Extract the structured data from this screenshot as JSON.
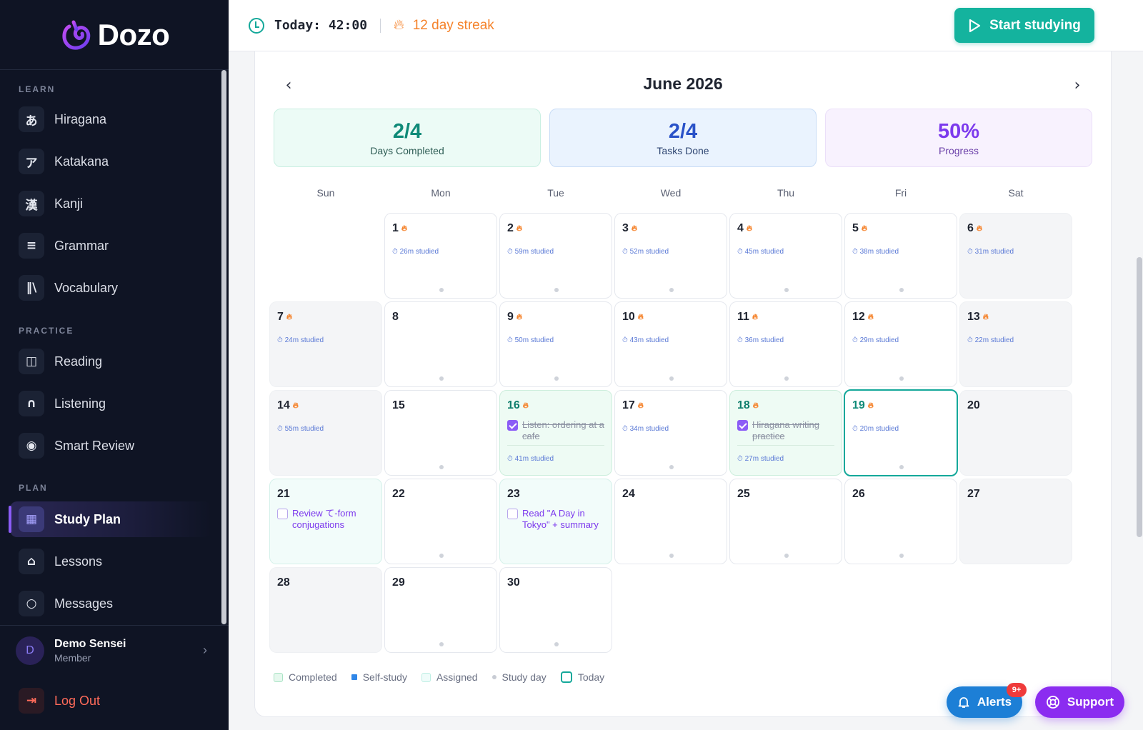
{
  "app": {
    "brand": "Dozo"
  },
  "sidebar": {
    "sections": [
      {
        "title": "LEARN",
        "items": [
          {
            "label": "Hiragana",
            "icon": "あ",
            "icon_name": "hiragana-icon"
          },
          {
            "label": "Katakana",
            "icon": "ア",
            "icon_name": "katakana-icon"
          },
          {
            "label": "Kanji",
            "icon": "漢",
            "icon_name": "kanji-icon"
          },
          {
            "label": "Grammar",
            "icon": "≡",
            "icon_name": "document-icon"
          },
          {
            "label": "Vocabulary",
            "icon": "‖\\",
            "icon_name": "library-icon"
          }
        ]
      },
      {
        "title": "PRACTICE",
        "items": [
          {
            "label": "Reading",
            "icon": "◫",
            "icon_name": "book-icon"
          },
          {
            "label": "Listening",
            "icon": "∩",
            "icon_name": "headphones-icon"
          },
          {
            "label": "Smart Review",
            "icon": "◉",
            "icon_name": "brain-icon"
          }
        ]
      },
      {
        "title": "PLAN",
        "items": [
          {
            "label": "Study Plan",
            "icon": "▦",
            "icon_name": "calendar-icon",
            "active": true
          },
          {
            "label": "Lessons",
            "icon": "⌂",
            "icon_name": "graduation-cap-icon"
          },
          {
            "label": "Messages",
            "icon": "○",
            "icon_name": "chat-bubble-icon"
          }
        ]
      }
    ],
    "user": {
      "initial": "D",
      "name": "Demo Sensei",
      "role": "Member"
    },
    "logout_label": "Log Out"
  },
  "topbar": {
    "timer": "Today: 42:00",
    "streak": "12 day streak",
    "start_label": "Start studying"
  },
  "calendar": {
    "month": "June 2026",
    "stats": [
      {
        "value": "2/4",
        "label": "Days Completed"
      },
      {
        "value": "2/4",
        "label": "Tasks Done"
      },
      {
        "value": "50%",
        "label": "Progress"
      }
    ],
    "weekdays": [
      "Sun",
      "Mon",
      "Tue",
      "Wed",
      "Thu",
      "Fri",
      "Sat"
    ],
    "first_weekday_index": 1,
    "days": [
      {
        "day": "1",
        "flame": true,
        "studied": "26m studied",
        "dot": true
      },
      {
        "day": "2",
        "flame": true,
        "studied": "59m studied",
        "dot": true
      },
      {
        "day": "3",
        "flame": true,
        "studied": "52m studied",
        "dot": true
      },
      {
        "day": "4",
        "flame": true,
        "studied": "45m studied",
        "dot": true
      },
      {
        "day": "5",
        "flame": true,
        "studied": "38m studied",
        "dot": true
      },
      {
        "day": "6",
        "flame": true,
        "studied": "31m studied",
        "dot": false
      },
      {
        "day": "7",
        "flame": true,
        "studied": "24m studied",
        "dot": false
      },
      {
        "day": "8",
        "flame": false,
        "studied": "",
        "dot": true
      },
      {
        "day": "9",
        "flame": true,
        "studied": "50m studied",
        "dot": true
      },
      {
        "day": "10",
        "flame": true,
        "studied": "43m studied",
        "dot": true
      },
      {
        "day": "11",
        "flame": true,
        "studied": "36m studied",
        "dot": true
      },
      {
        "day": "12",
        "flame": true,
        "studied": "29m studied",
        "dot": true
      },
      {
        "day": "13",
        "flame": true,
        "studied": "22m studied",
        "dot": false
      },
      {
        "day": "14",
        "flame": true,
        "studied": "55m studied",
        "dot": false
      },
      {
        "day": "15",
        "flame": false,
        "studied": "",
        "dot": true
      },
      {
        "day": "16",
        "flame": true,
        "studied": "41m studied",
        "dot": false,
        "status": "completed",
        "task": {
          "text": "Listen: ordering at a cafe",
          "done": true
        }
      },
      {
        "day": "17",
        "flame": true,
        "studied": "34m studied",
        "dot": true
      },
      {
        "day": "18",
        "flame": true,
        "studied": "27m studied",
        "dot": false,
        "status": "completed",
        "task": {
          "text": "Hiragana writing practice",
          "done": true
        }
      },
      {
        "day": "19",
        "flame": true,
        "studied": "20m studied",
        "dot": true,
        "status": "today"
      },
      {
        "day": "20",
        "flame": false,
        "studied": "",
        "dot": false
      },
      {
        "day": "21",
        "flame": false,
        "studied": "",
        "dot": false,
        "status": "assigned",
        "task": {
          "text": "Review て-form conjugations",
          "done": false
        }
      },
      {
        "day": "22",
        "flame": false,
        "studied": "",
        "dot": true
      },
      {
        "day": "23",
        "flame": false,
        "studied": "",
        "dot": false,
        "status": "assigned",
        "task": {
          "text": "Read \"A Day in Tokyo\" + summary",
          "done": false
        }
      },
      {
        "day": "24",
        "flame": false,
        "studied": "",
        "dot": true
      },
      {
        "day": "25",
        "flame": false,
        "studied": "",
        "dot": true
      },
      {
        "day": "26",
        "flame": false,
        "studied": "",
        "dot": true
      },
      {
        "day": "27",
        "flame": false,
        "studied": "",
        "dot": false
      },
      {
        "day": "28",
        "flame": false,
        "studied": "",
        "dot": false
      },
      {
        "day": "29",
        "flame": false,
        "studied": "",
        "dot": true
      },
      {
        "day": "30",
        "flame": false,
        "studied": "",
        "dot": true
      }
    ],
    "legend": [
      {
        "label": "Completed",
        "swatch": "completed"
      },
      {
        "label": "Self-study",
        "swatch": "self"
      },
      {
        "label": "Assigned",
        "swatch": "assigned"
      },
      {
        "label": "Study day",
        "swatch": "dot"
      },
      {
        "label": "Today",
        "swatch": "today"
      }
    ]
  },
  "floating": {
    "alerts_label": "Alerts",
    "alerts_badge": "9+",
    "support_label": "Support"
  },
  "colors": {
    "sidebar_bg": "#0f1424",
    "accent_teal": "#14b39e",
    "accent_purple": "#8b5cf6",
    "streak_orange": "#f5822a",
    "alerts_blue": "#1d7fd6",
    "support_purple": "#8b2cf0"
  }
}
